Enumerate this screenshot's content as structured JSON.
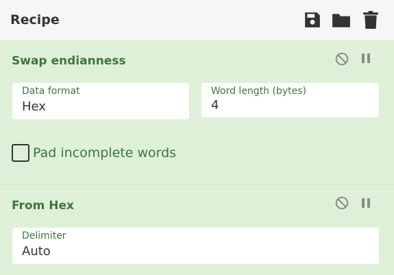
{
  "recipe": {
    "title": "Recipe",
    "icons": [
      "save-icon",
      "folder-icon",
      "trash-icon"
    ]
  },
  "ops": [
    {
      "title": "Swap endianness",
      "fields": [
        {
          "label": "Data format",
          "value": "Hex"
        },
        {
          "label": "Word length (bytes)",
          "value": "4"
        }
      ],
      "checkbox": {
        "label": "Pad incomplete words",
        "checked": false
      },
      "controls": [
        "disable-icon",
        "pause-icon"
      ]
    },
    {
      "title": "From Hex",
      "fields": [
        {
          "label": "Delimiter",
          "value": "Auto"
        }
      ],
      "controls": [
        "disable-icon",
        "pause-icon"
      ]
    }
  ],
  "colors": {
    "header_bg": "#f6f6f6",
    "op_bg": "#dff0d8",
    "op_title": "#3c763d",
    "icon_dark": "#333333",
    "icon_muted": "#8a8a8a"
  }
}
